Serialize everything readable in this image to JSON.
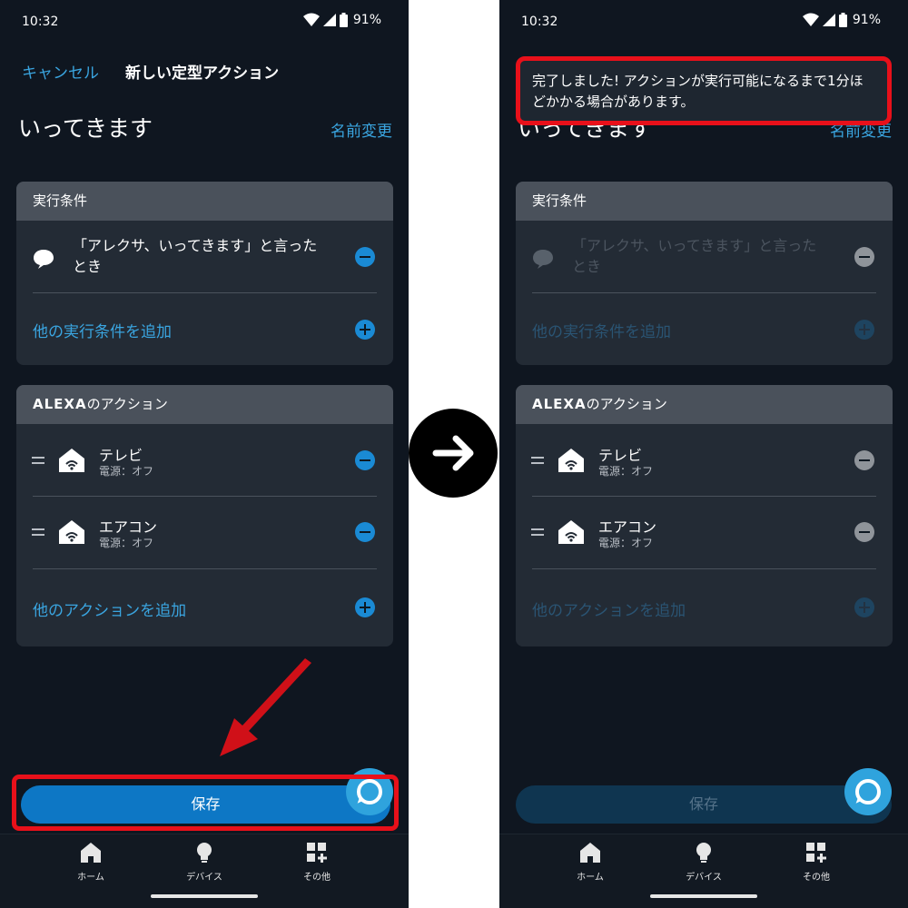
{
  "status_bar": {
    "time": "10:32",
    "battery": "91%"
  },
  "header": {
    "cancel": "キャンセル",
    "title": "新しい定型アクション"
  },
  "routine": {
    "name": "いってきます",
    "rename": "名前変更"
  },
  "trigger_section": {
    "title": "実行条件",
    "trigger_text": "「アレクサ、いってきます」と言ったとき",
    "add_label": "他の実行条件を追加"
  },
  "action_section": {
    "title_prefix": "ALEXA",
    "title_suffix": "のアクション",
    "actions": [
      {
        "name": "テレビ",
        "state": "電源：オフ"
      },
      {
        "name": "エアコン",
        "state": "電源：オフ"
      }
    ],
    "add_label": "他のアクションを追加"
  },
  "save_label": "保存",
  "toast": {
    "message": "完了しました! アクションが実行可能になるまで1分ほどかかる場合があります。"
  },
  "bottom_nav": [
    {
      "label": "ホーム",
      "icon": "home-icon"
    },
    {
      "label": "デバイス",
      "icon": "bulb-icon"
    },
    {
      "label": "その他",
      "icon": "grid-plus-icon"
    }
  ],
  "colors": {
    "background": "#0f1620",
    "accent": "#3aa5e0",
    "save_button": "#0d77c5",
    "highlight": "#e8101a",
    "alexa": "#2fa3dd"
  }
}
